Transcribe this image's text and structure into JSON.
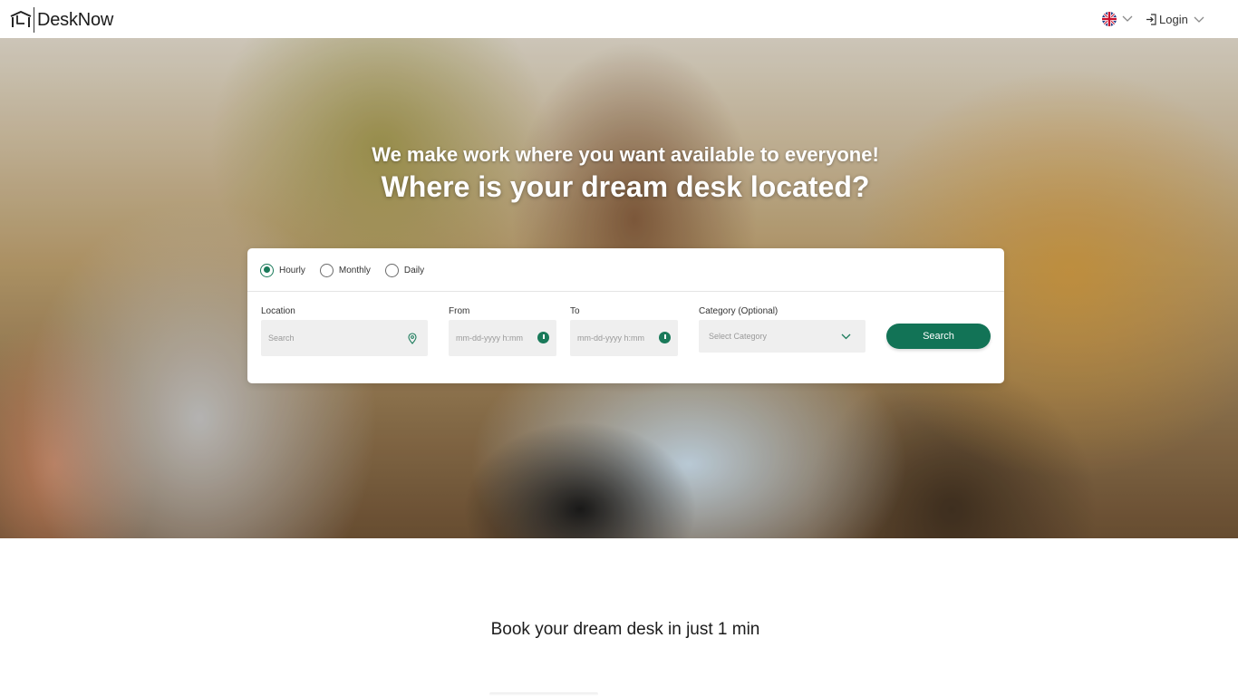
{
  "header": {
    "brand": "DeskNow",
    "language_icon": "uk-flag-icon",
    "login_label": "Login"
  },
  "hero": {
    "subtitle": "We make work where you want available to everyone!",
    "title": "Where is your dream desk located?"
  },
  "search": {
    "booking_types": [
      {
        "label": "Hourly",
        "selected": true
      },
      {
        "label": "Monthly",
        "selected": false
      },
      {
        "label": "Daily",
        "selected": false
      }
    ],
    "location_label": "Location",
    "location_placeholder": "Search",
    "from_label": "From",
    "from_placeholder": "mm-dd-yyyy h:mm",
    "to_label": "To",
    "to_placeholder": "mm-dd-yyyy h:mm",
    "category_label": "Category (Optional)",
    "category_value": "Select Category",
    "button_label": "Search"
  },
  "section": {
    "heading": "Book your dream desk in just 1 min"
  },
  "colors": {
    "accent": "#127356",
    "field_bg": "#efefef"
  }
}
